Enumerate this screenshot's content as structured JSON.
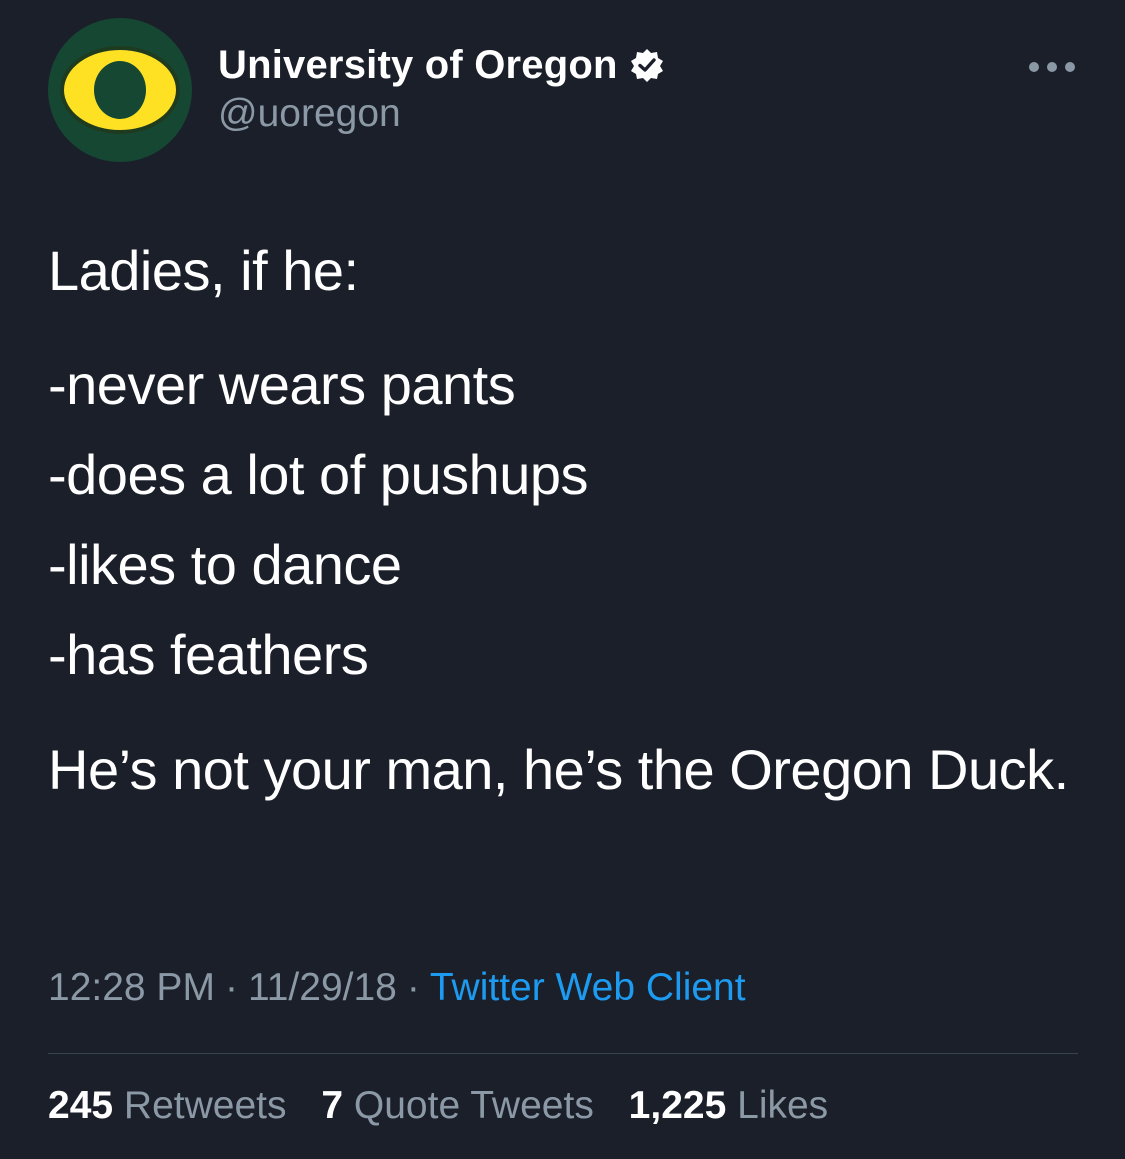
{
  "user": {
    "display_name": "University of Oregon",
    "handle": "@uoregon",
    "avatar_letter": "O",
    "verified_icon": "verified-badge-icon",
    "avatar_colors": {
      "bg": "#154733",
      "ring": "#fee123"
    }
  },
  "tweet": {
    "intro": "Ladies, if he:",
    "items": [
      "-never wears pants",
      "-does a lot of pushups",
      "-likes to dance",
      "-has feathers"
    ],
    "outro": "He’s not your man, he’s the Oregon Duck."
  },
  "meta": {
    "time": "12:28 PM",
    "date": "11/29/18",
    "separator": "·",
    "client": "Twitter Web Client"
  },
  "stats": {
    "retweets_count": "245",
    "retweets_label": "Retweets",
    "quotes_count": "7",
    "quotes_label": "Quote Tweets",
    "likes_count": "1,225",
    "likes_label": "Likes"
  },
  "colors": {
    "background": "#1b1f2a",
    "text": "#ffffff",
    "secondary": "#8b98a5",
    "link": "#1d9bf0",
    "divider": "#38444d"
  }
}
